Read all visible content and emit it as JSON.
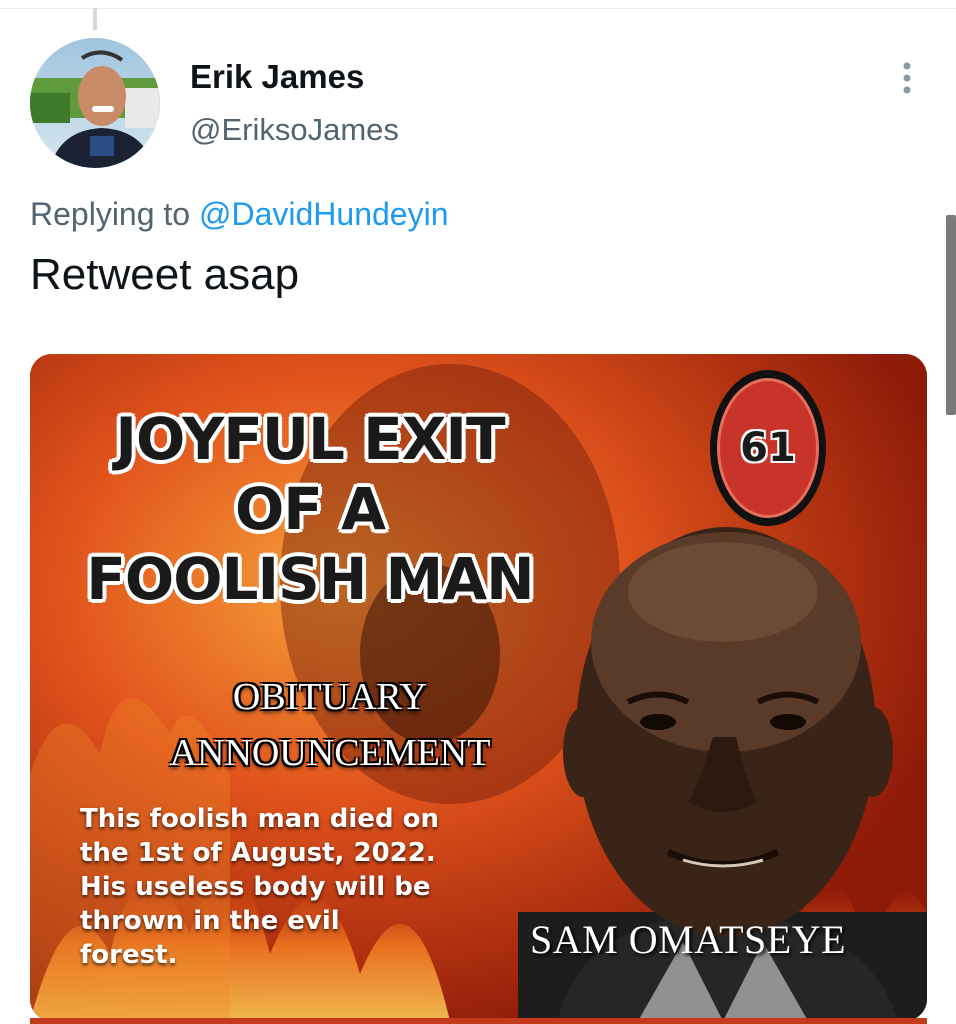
{
  "tweet": {
    "author_name": "Erik James",
    "author_handle": "@EriksoJames",
    "reply_prefix": "Replying to",
    "reply_mention": "@DavidHundeyin",
    "text": "Retweet asap",
    "more_icon": "more-vertical-icon"
  },
  "image": {
    "headline_lines": [
      "Joyful Exit",
      "of a",
      "Foolish Man"
    ],
    "badge": "61",
    "obituary_lines": [
      "OBITUARY",
      "ANNOUNCEMENT"
    ],
    "body_text": "This foolish man died on the 1st of August, 2022. His useless body will be thrown in the evil forest.",
    "name": "SAM OMATSEYE"
  },
  "colors": {
    "handle_gray": "#536471",
    "link_blue": "#1d9bf0",
    "fire_red": "#c43a1a"
  }
}
